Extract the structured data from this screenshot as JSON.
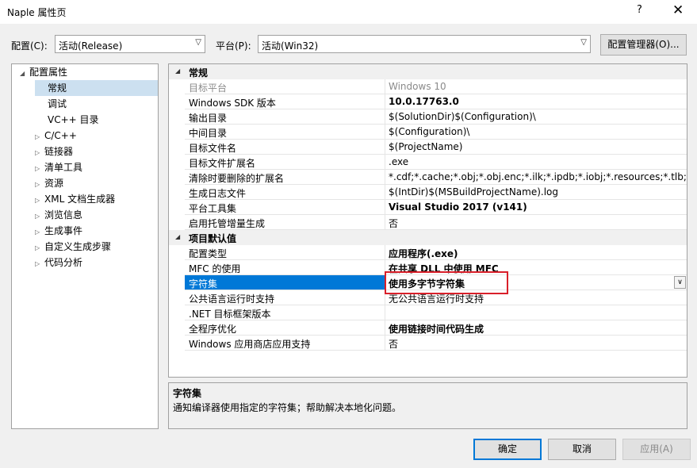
{
  "window": {
    "title": "Naple 属性页",
    "help_glyph": "?",
    "close_glyph": "✕"
  },
  "toolbar": {
    "config_label": "配置(C):",
    "config_value": "活动(Release)",
    "platform_label": "平台(P):",
    "platform_value": "活动(Win32)",
    "config_manager_label": "配置管理器(O)..."
  },
  "tree": {
    "root": "配置属性",
    "items": [
      {
        "label": "常规",
        "expandable": false,
        "selected": true
      },
      {
        "label": "调试",
        "expandable": false
      },
      {
        "label": "VC++ 目录",
        "expandable": false
      },
      {
        "label": "C/C++",
        "expandable": true
      },
      {
        "label": "链接器",
        "expandable": true
      },
      {
        "label": "清单工具",
        "expandable": true
      },
      {
        "label": "资源",
        "expandable": true
      },
      {
        "label": "XML 文档生成器",
        "expandable": true
      },
      {
        "label": "浏览信息",
        "expandable": true
      },
      {
        "label": "生成事件",
        "expandable": true
      },
      {
        "label": "自定义生成步骤",
        "expandable": true
      },
      {
        "label": "代码分析",
        "expandable": true
      }
    ]
  },
  "grid": {
    "sections": [
      {
        "title": "常规",
        "rows": [
          {
            "name": "目标平台",
            "value": "Windows 10",
            "dim": true
          },
          {
            "name": "Windows SDK 版本",
            "value": "10.0.17763.0",
            "bold": true
          },
          {
            "name": "输出目录",
            "value": "$(SolutionDir)$(Configuration)\\"
          },
          {
            "name": "中间目录",
            "value": "$(Configuration)\\"
          },
          {
            "name": "目标文件名",
            "value": "$(ProjectName)"
          },
          {
            "name": "目标文件扩展名",
            "value": ".exe"
          },
          {
            "name": "清除时要删除的扩展名",
            "value": "*.cdf;*.cache;*.obj;*.obj.enc;*.ilk;*.ipdb;*.iobj;*.resources;*.tlb;*.tli;*.t"
          },
          {
            "name": "生成日志文件",
            "value": "$(IntDir)$(MSBuildProjectName).log"
          },
          {
            "name": "平台工具集",
            "value": "Visual Studio 2017 (v141)",
            "bold": true
          },
          {
            "name": "启用托管增量生成",
            "value": "否"
          }
        ]
      },
      {
        "title": "项目默认值",
        "rows": [
          {
            "name": "配置类型",
            "value": "应用程序(.exe)",
            "bold": true
          },
          {
            "name": "MFC 的使用",
            "value": "在共享 DLL 中使用 MFC",
            "bold": true
          },
          {
            "name": "字符集",
            "value": "使用多字节字符集",
            "bold": true,
            "selected": true
          },
          {
            "name": "公共语言运行时支持",
            "value": "无公共语言运行时支持"
          },
          {
            "name": ".NET 目标框架版本",
            "value": ""
          },
          {
            "name": "全程序优化",
            "value": "使用链接时间代码生成",
            "bold": true
          },
          {
            "name": "Windows 应用商店应用支持",
            "value": "否"
          }
        ]
      }
    ]
  },
  "description": {
    "title": "字符集",
    "text": "通知编译器使用指定的字符集；帮助解决本地化问题。"
  },
  "buttons": {
    "ok": "确定",
    "cancel": "取消",
    "apply": "应用(A)"
  },
  "colors": {
    "selection": "#0078d7",
    "highlight_box": "#d9202a",
    "tree_selection": "#cce0f0"
  },
  "icons": {
    "dropdown": "chevron-down-icon",
    "expand": "triangle-right-icon",
    "collapse": "triangle-down-icon"
  }
}
